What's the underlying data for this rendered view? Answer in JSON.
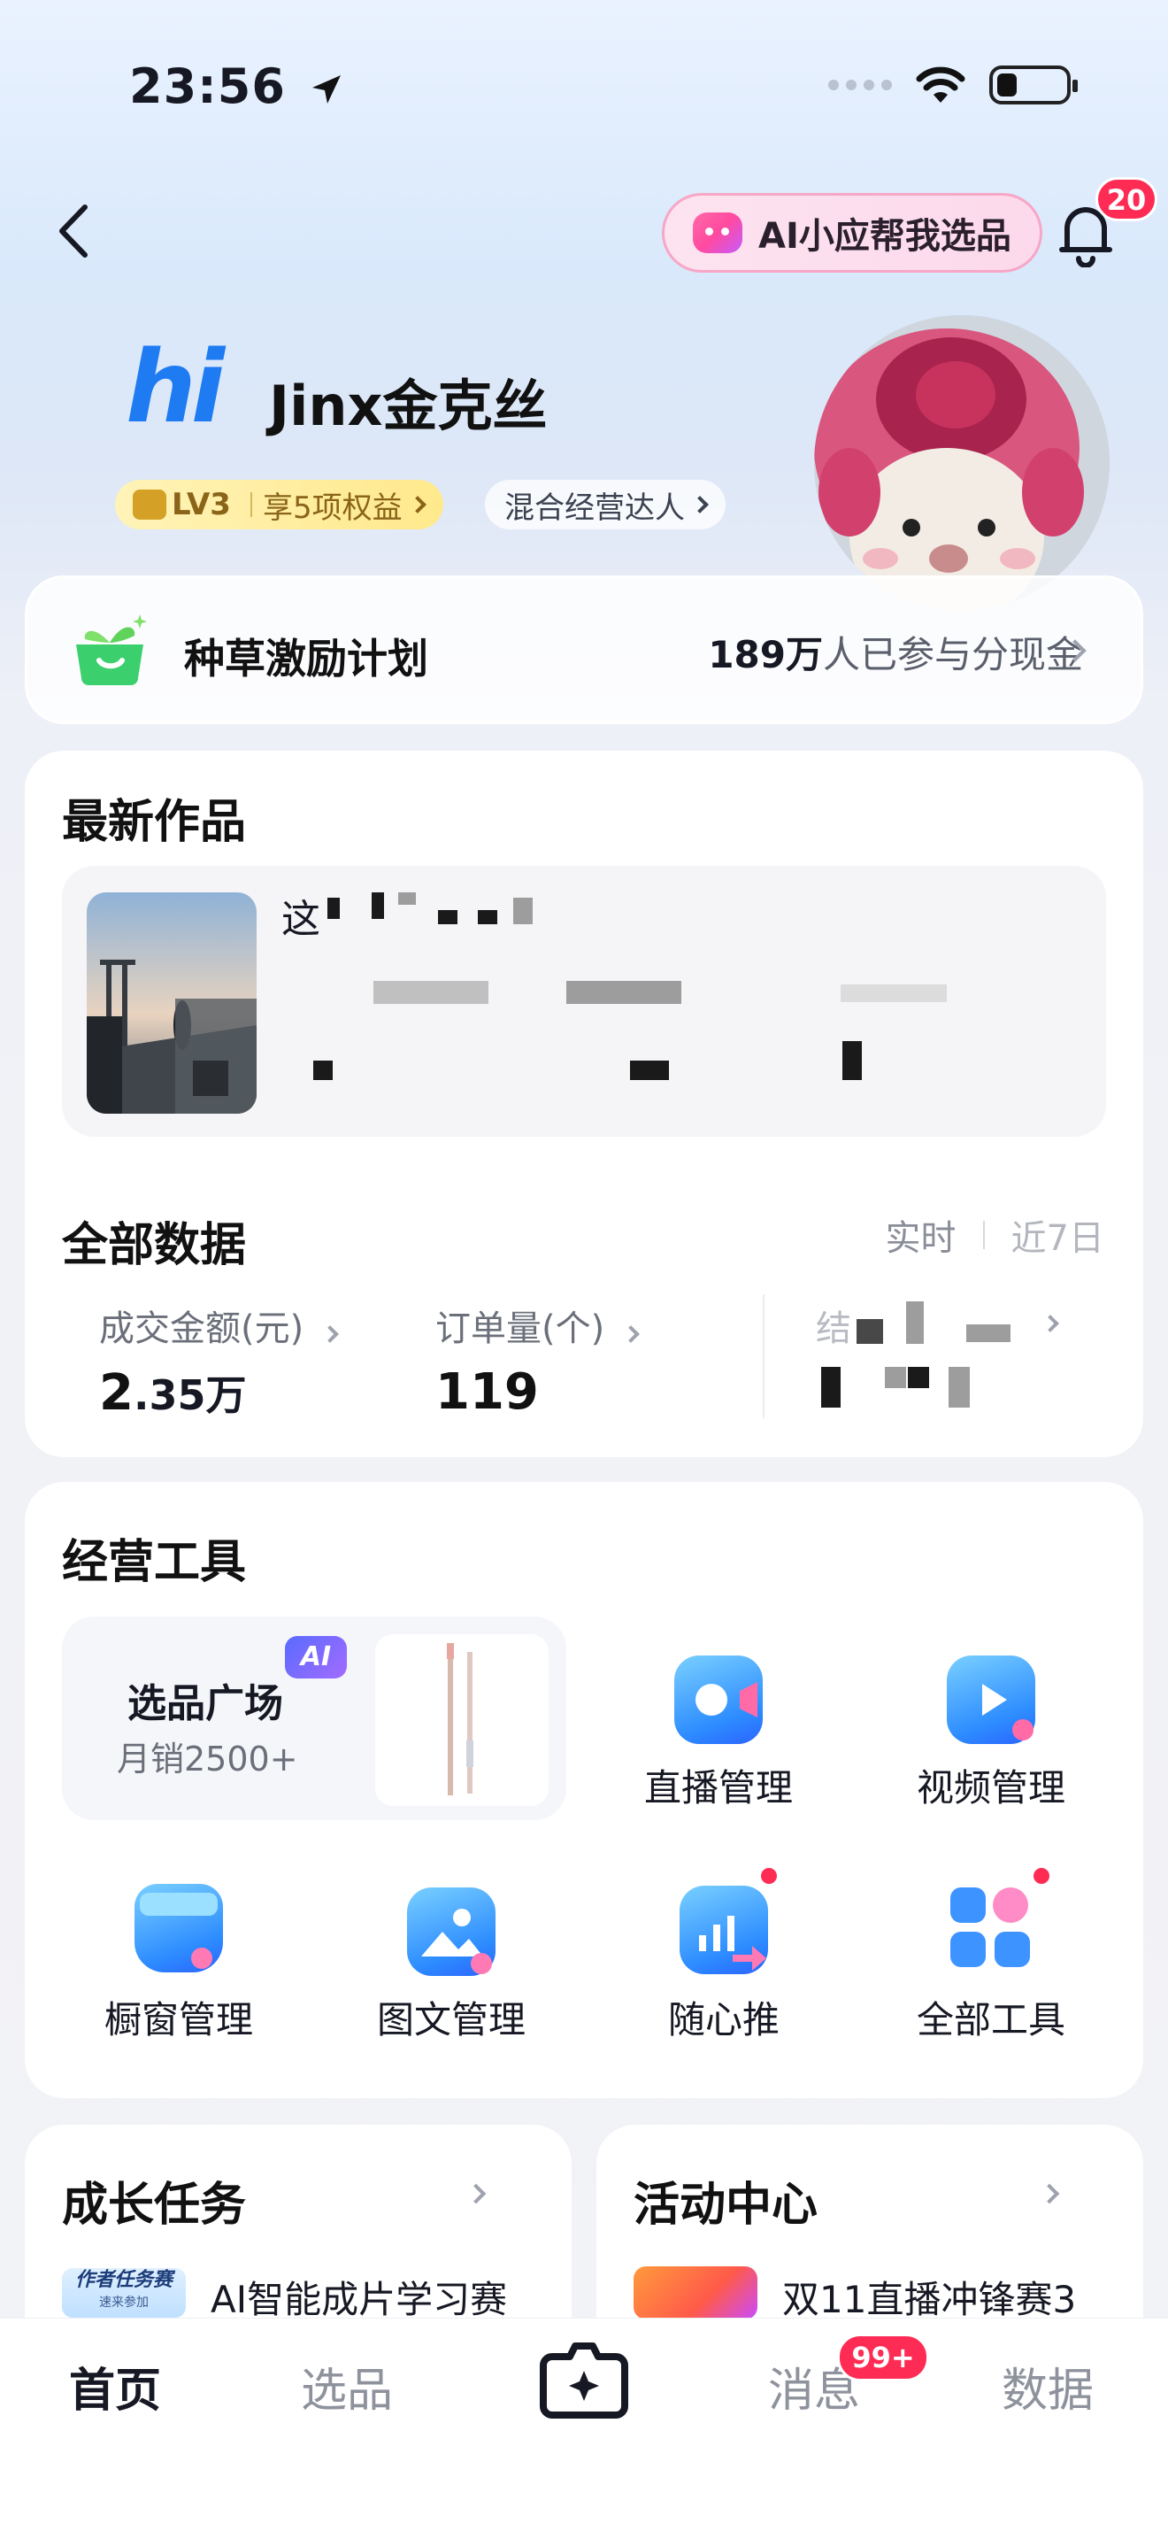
{
  "status_bar": {
    "time": "23:56"
  },
  "header": {
    "ai_button_label": "AI小应帮我选品",
    "notification_count": "20"
  },
  "profile": {
    "greeting_logo": "hi",
    "username": "Jinx金克丝",
    "level": "LV3",
    "level_benefit": "享5项权益",
    "creator_tag": "混合经营达人"
  },
  "incentive": {
    "title": "种草激励计划",
    "count": "189万",
    "suffix": "人已参与分现金"
  },
  "latest_works": {
    "title": "最新作品",
    "caption_prefix": "这"
  },
  "all_data": {
    "title": "全部数据",
    "tab_realtime": "实时",
    "tab_7days": "近7日",
    "metrics": [
      {
        "label": "成交金额(元)",
        "value_main": "2",
        "value_decimal": ".35万"
      },
      {
        "label": "订单量(个)",
        "value": "119"
      }
    ],
    "third_metric_label_prefix": "结"
  },
  "tools": {
    "title": "经营工具",
    "featured": {
      "label": "选品广场",
      "sub": "月销2500+",
      "ai_tag": "AI"
    },
    "items": [
      {
        "label": "直播管理",
        "icon": "live-camera-icon"
      },
      {
        "label": "视频管理",
        "icon": "video-play-icon"
      },
      {
        "label": "橱窗管理",
        "icon": "shop-window-icon"
      },
      {
        "label": "图文管理",
        "icon": "image-text-icon"
      },
      {
        "label": "随心推",
        "icon": "boost-icon"
      },
      {
        "label": "全部工具",
        "icon": "all-tools-icon"
      }
    ]
  },
  "growth_tasks": {
    "title": "成长任务",
    "item": "AI智能成片学习赛",
    "thumb_text": "作者任务赛",
    "thumb_sub": "速来参加"
  },
  "activity_center": {
    "title": "活动中心",
    "item": "双11直播冲锋赛3"
  },
  "bottom_nav": {
    "home": "首页",
    "select": "选品",
    "messages": "消息",
    "messages_badge": "99+",
    "data": "数据"
  },
  "colors": {
    "accent": "#fe2c55",
    "tool_blue": "#2d8cff",
    "gold": "#ffe98c"
  }
}
